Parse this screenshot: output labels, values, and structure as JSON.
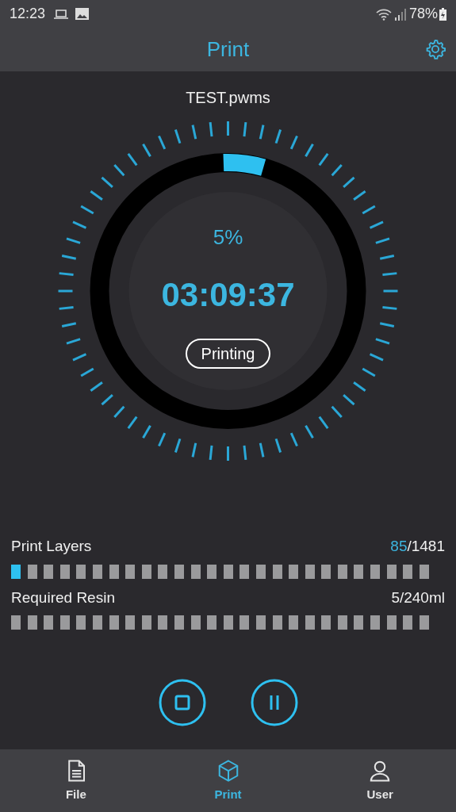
{
  "status_bar": {
    "time": "12:23",
    "battery": "78%"
  },
  "header": {
    "title": "Print"
  },
  "job": {
    "file_name": "TEST.pwms",
    "percent": "5%",
    "remaining": "03:09:37",
    "state": "Printing"
  },
  "stats": [
    {
      "label": "Print Layers",
      "done": "85",
      "total": "/1481",
      "level": 0.057
    },
    {
      "label": "Required Resin",
      "total": "5/240ml"
    }
  ],
  "controls": [
    {
      "kind": "stop"
    },
    {
      "kind": "pause"
    }
  ],
  "nav": [
    {
      "label": "File",
      "kind": "file",
      "selected": false
    },
    {
      "label": "Print",
      "kind": "print",
      "selected": true
    },
    {
      "label": "User",
      "kind": "user",
      "selected": false
    }
  ]
}
